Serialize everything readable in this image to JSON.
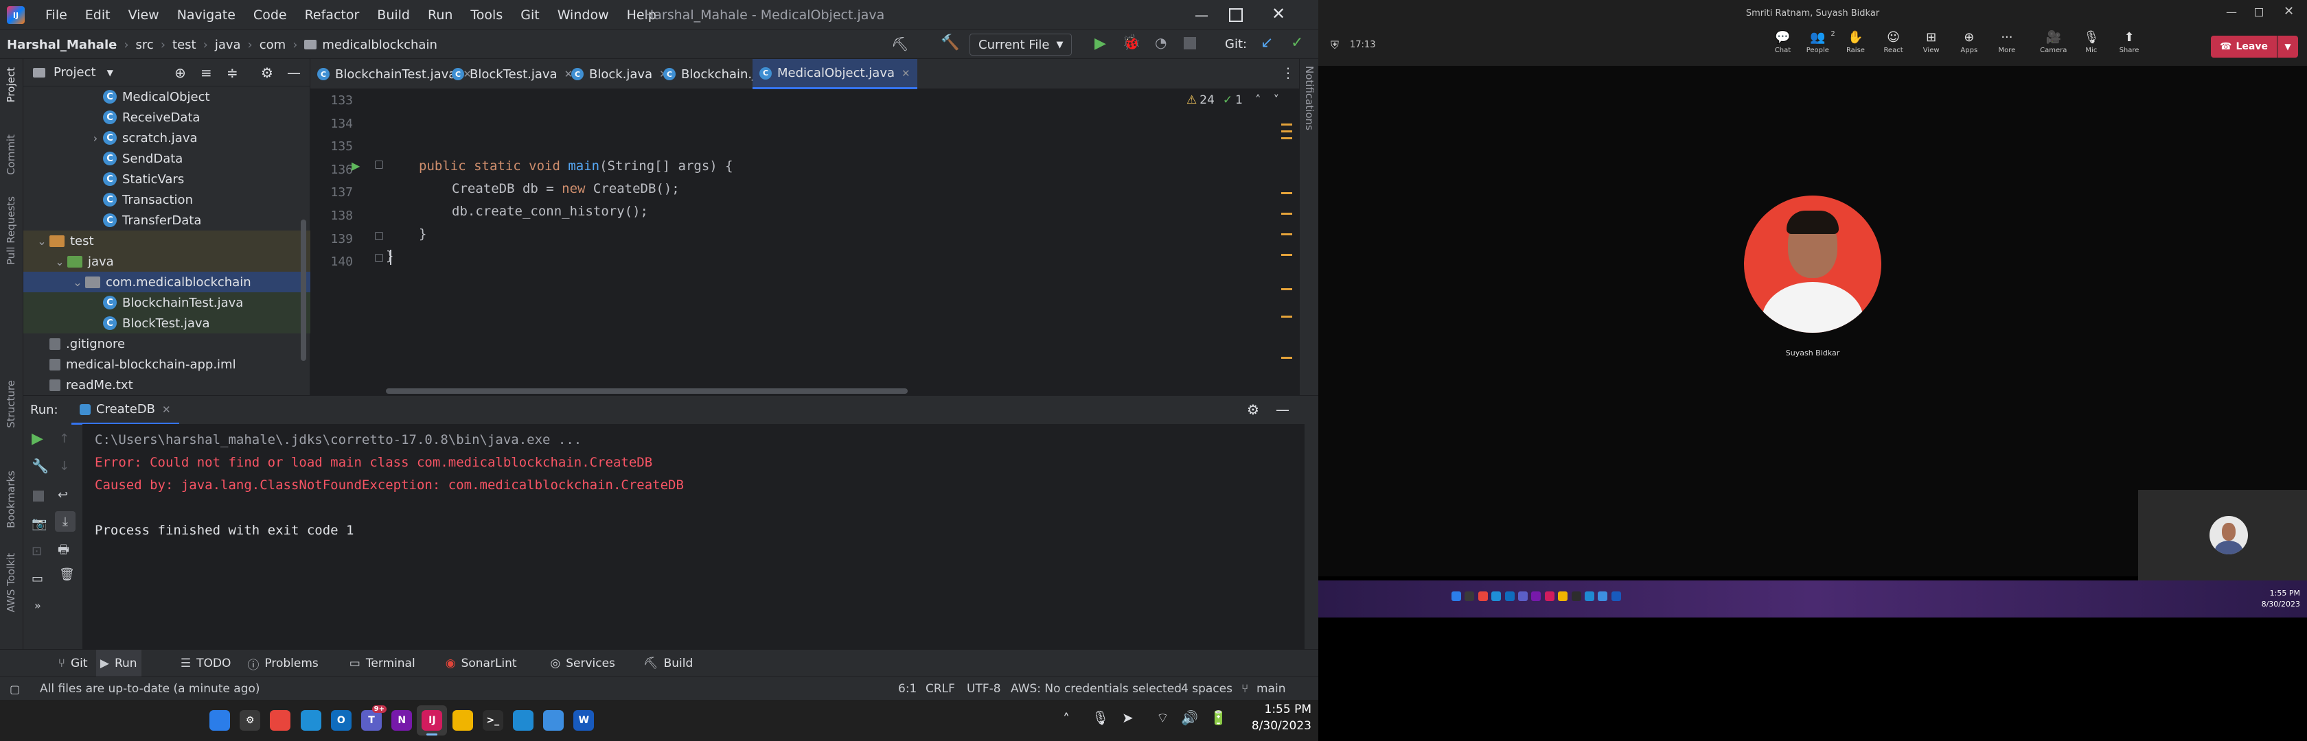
{
  "ide": {
    "app_icon": "intellij-icon",
    "menu": [
      "File",
      "Edit",
      "View",
      "Navigate",
      "Code",
      "Refactor",
      "Build",
      "Run",
      "Tools",
      "Git",
      "Window",
      "Help"
    ],
    "title": "Harshal_Mahale - MedicalObject.java",
    "breadcrumb": [
      "Harshal_Mahale",
      "src",
      "test",
      "java",
      "com",
      "medicalblockchain"
    ],
    "run_config": "Current File",
    "git_label": "Git:",
    "project_label": "Project",
    "tree": [
      {
        "label": "MedicalObject",
        "kind": "class",
        "indent": 4
      },
      {
        "label": "ReceiveData",
        "kind": "class",
        "indent": 4
      },
      {
        "label": "scratch.java",
        "kind": "class",
        "indent": 4,
        "arrow": "›"
      },
      {
        "label": "SendData",
        "kind": "class",
        "indent": 4
      },
      {
        "label": "StaticVars",
        "kind": "class",
        "indent": 4
      },
      {
        "label": "Transaction",
        "kind": "class",
        "indent": 4
      },
      {
        "label": "TransferData",
        "kind": "class",
        "indent": 4
      },
      {
        "label": "test",
        "kind": "folder",
        "indent": 1,
        "arrow": "⌄"
      },
      {
        "label": "java",
        "kind": "greenfolder",
        "indent": 2,
        "arrow": "⌄"
      },
      {
        "label": "com.medicalblockchain",
        "kind": "package",
        "indent": 3,
        "arrow": "⌄",
        "selected": true
      },
      {
        "label": "BlockchainTest.java",
        "kind": "testfile",
        "indent": 4
      },
      {
        "label": "BlockTest.java",
        "kind": "testfile",
        "indent": 4
      },
      {
        "label": ".gitignore",
        "kind": "file",
        "indent": 1
      },
      {
        "label": "medical-blockchain-app.iml",
        "kind": "file",
        "indent": 1
      },
      {
        "label": "readMe.txt",
        "kind": "file",
        "indent": 1
      }
    ],
    "tabs": [
      "BlockchainTest.java",
      "BlockTest.java",
      "Block.java",
      "Blockchain.java",
      "MedicalObject.java"
    ],
    "active_tab": 4,
    "warnings": "24",
    "weak_warnings": "1",
    "line_numbers": [
      "133",
      "134",
      "135",
      "136",
      "137",
      "138",
      "139",
      "140"
    ],
    "code": {
      "l136_kw": "public static void ",
      "l136_fn": "main",
      "l136_rest": "(String[] args) {",
      "l137_a": "CreateDB db = ",
      "l137_kw": "new ",
      "l137_b": "CreateDB();",
      "l138": "db.create_conn_history();",
      "l139": "}",
      "l140": "}"
    },
    "run_label": "Run:",
    "run_tab": "CreateDB",
    "console": [
      {
        "text": "C:\\Users\\harshal_mahale\\.jdks\\corretto-17.0.8\\bin\\java.exe ...",
        "kind": "cmd"
      },
      {
        "text": "Error: Could not find or load main class com.medicalblockchain.CreateDB",
        "kind": "err"
      },
      {
        "text": "Caused by: java.lang.ClassNotFoundException: com.medicalblockchain.CreateDB",
        "kind": "err"
      },
      {
        "text": "",
        "kind": "out"
      },
      {
        "text": "Process finished with exit code 1",
        "kind": "out"
      }
    ],
    "left_stripe": [
      "Project",
      "Commit",
      "Pull Requests",
      "Structure",
      "Bookmarks",
      "AWS Toolkit"
    ],
    "right_stripe": "Notifications",
    "tool_tabs": [
      "Git",
      "Run",
      "TODO",
      "Problems",
      "Terminal",
      "SonarLint",
      "Services",
      "Build"
    ],
    "status_left": "All files are up-to-date (a minute ago)",
    "status_right": [
      "6:1",
      "CRLF",
      "UTF-8",
      "AWS: No credentials selected",
      "4 spaces",
      "main"
    ]
  },
  "taskbar_left": {
    "time": "1:55 PM",
    "date": "8/30/2023",
    "apps": [
      {
        "name": "windows-start-icon",
        "label": "",
        "color": "#2b7de9"
      },
      {
        "name": "settings-icon",
        "label": "⚙",
        "color": "#3a3a3a"
      },
      {
        "name": "chrome-icon",
        "label": "",
        "color": "#e8453c"
      },
      {
        "name": "edge-icon",
        "label": "",
        "color": "#1f8fd6"
      },
      {
        "name": "outlook-icon",
        "label": "O",
        "color": "#0f6cbd"
      },
      {
        "name": "teams-icon",
        "label": "T",
        "color": "#5b5fc7",
        "badge": "9+"
      },
      {
        "name": "onenote-icon",
        "label": "N",
        "color": "#7719aa"
      },
      {
        "name": "intellij-icon",
        "label": "IJ",
        "color": "#d21c5e",
        "active": true
      },
      {
        "name": "file-explorer-icon",
        "label": "",
        "color": "#f0b400"
      },
      {
        "name": "terminal-icon",
        "label": ">_",
        "color": "#2d2d2d"
      },
      {
        "name": "vscode-icon",
        "label": "",
        "color": "#1f8ad2"
      },
      {
        "name": "notepad-icon",
        "label": "",
        "color": "#3d8ee0"
      },
      {
        "name": "word-icon",
        "label": "W",
        "color": "#185abd"
      }
    ]
  },
  "teams": {
    "participants": "Smriti Ratnam, Suyash Bidkar",
    "elapsed": "17:13",
    "controls": [
      {
        "label": "Chat",
        "glyph": "💬"
      },
      {
        "label": "People",
        "glyph": "👥",
        "badge": "2"
      },
      {
        "label": "Raise",
        "glyph": "✋"
      },
      {
        "label": "React",
        "glyph": "☺"
      },
      {
        "label": "View",
        "glyph": "⊞"
      },
      {
        "label": "Apps",
        "glyph": "⊕"
      },
      {
        "label": "More",
        "glyph": "···"
      }
    ],
    "av_controls": [
      {
        "label": "Camera",
        "glyph": "🎥"
      },
      {
        "label": "Mic",
        "glyph": "🎙"
      },
      {
        "label": "Share",
        "glyph": "⬆"
      }
    ],
    "leave_label": "Leave",
    "speaker_name": "Suyash Bidkar",
    "shared_time": "1:55 PM",
    "shared_date": "8/30/2023"
  }
}
